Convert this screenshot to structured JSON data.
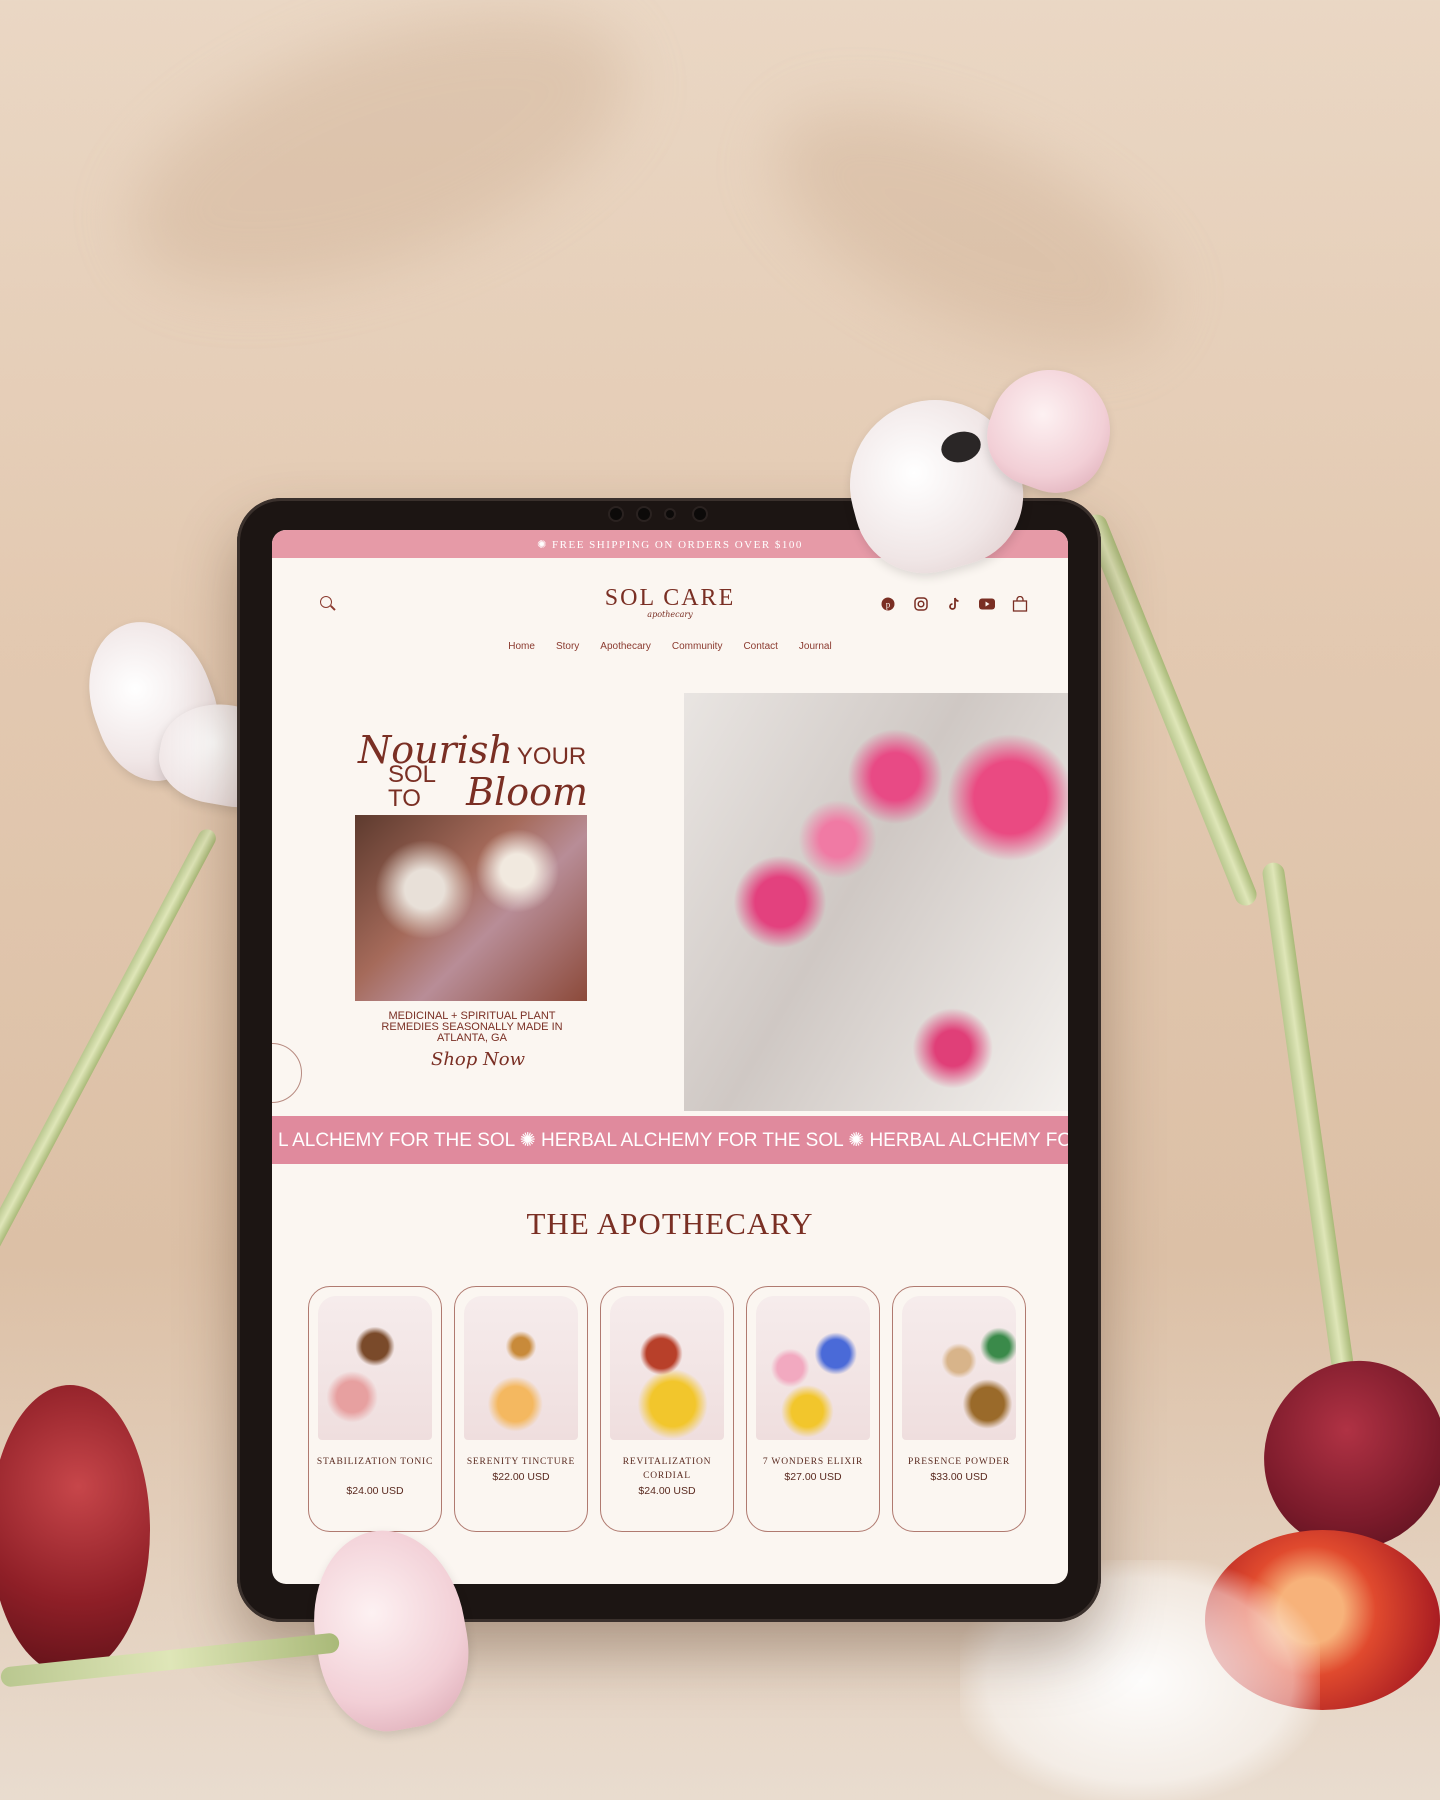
{
  "announcement": "✺ FREE SHIPPING ON ORDERS OVER $100",
  "logo": {
    "brand": "SOL CARE",
    "sub": "apothecary"
  },
  "social_icons": [
    "pinterest-icon",
    "instagram-icon",
    "tiktok-icon",
    "youtube-icon",
    "cart-icon"
  ],
  "nav": [
    "Home",
    "Story",
    "Apothecary",
    "Community",
    "Contact",
    "Journal"
  ],
  "hero": {
    "script1": "Nourish",
    "caps1": "YOUR",
    "caps2": "SOL TO",
    "script2": "Bloom",
    "tagline": "MEDICINAL + SPIRITUAL PLANT REMEDIES SEASONALLY MADE IN ATLANTA, GA",
    "cta": "Shop Now"
  },
  "marquee": "L ALCHEMY FOR THE SOL ✺ HERBAL ALCHEMY FOR THE SOL ✺ HERBAL ALCHEMY FOR THE SOL",
  "section_title": "THE APOTHECARY",
  "products": [
    {
      "name": "Stabilization Tonic",
      "price": "$24.00 USD"
    },
    {
      "name": "Serenity Tincture",
      "price": "$22.00 USD"
    },
    {
      "name": "Revitalization Cordial",
      "price": "$24.00 USD"
    },
    {
      "name": "7 Wonders Elixir",
      "price": "$27.00 USD"
    },
    {
      "name": "Presence Powder",
      "price": "$33.00 USD"
    }
  ],
  "colors": {
    "accent_pink": "#e69aa7",
    "brand_brown": "#7a2f24",
    "cream": "#fbf6f1"
  }
}
